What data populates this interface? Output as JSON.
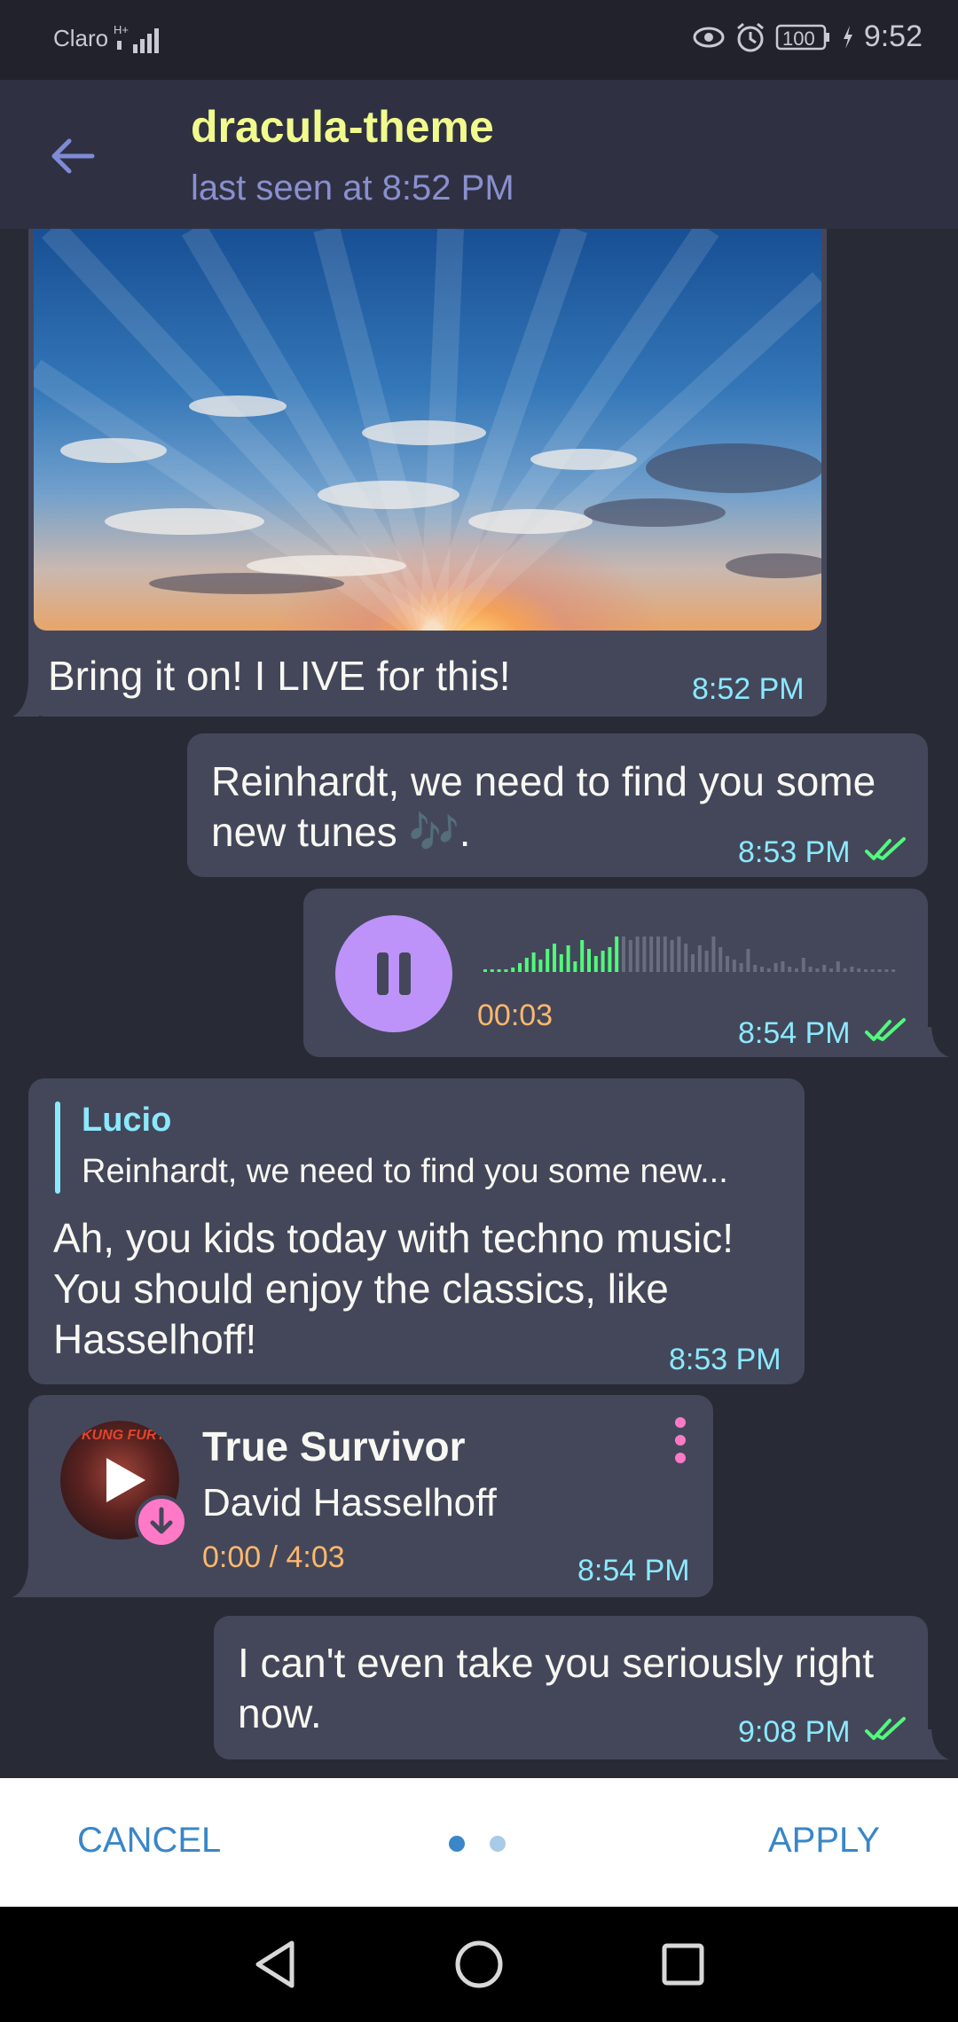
{
  "status": {
    "carrier": "Claro",
    "battery": "100",
    "time": "9:52"
  },
  "header": {
    "title": "dracula-theme",
    "subtitle": "last seen at 8:52 PM"
  },
  "messages": {
    "photo": {
      "caption": "Bring it on! I LIVE for this!",
      "time": "8:52 PM"
    },
    "m2": {
      "text_line1": "Reinhardt, we need to find you some",
      "text_line2": "new tunes 🎶.",
      "time": "8:53 PM"
    },
    "voice": {
      "duration": "00:03",
      "time": "8:54 PM",
      "progress": 0.33
    },
    "reply": {
      "quote_author": "Lucio",
      "quote_text": "Reinhardt, we need to find you some new...",
      "text_line1": "Ah, you kids today with techno music!",
      "text_line2": "You should enjoy the classics, like",
      "text_line3": "Hasselhoff!",
      "time": "8:53 PM"
    },
    "music": {
      "title": "True Survivor",
      "artist": "David Hasselhoff",
      "progress": "0:00 / 4:03",
      "time": "8:54 PM",
      "cover_text": "KUNG FURY"
    },
    "m6": {
      "text_line1": "I can't even take you seriously right",
      "text_line2": "now.",
      "time": "9:08 PM"
    }
  },
  "bottom": {
    "cancel": "CANCEL",
    "apply": "APPLY"
  },
  "colors": {
    "accent_purple": "#bd93f9",
    "accent_green": "#50fa7b",
    "accent_pink": "#ff79c6",
    "accent_cyan": "#8be9fd",
    "accent_orange": "#ffb86c",
    "accent_yellow": "#f1fa8c"
  }
}
